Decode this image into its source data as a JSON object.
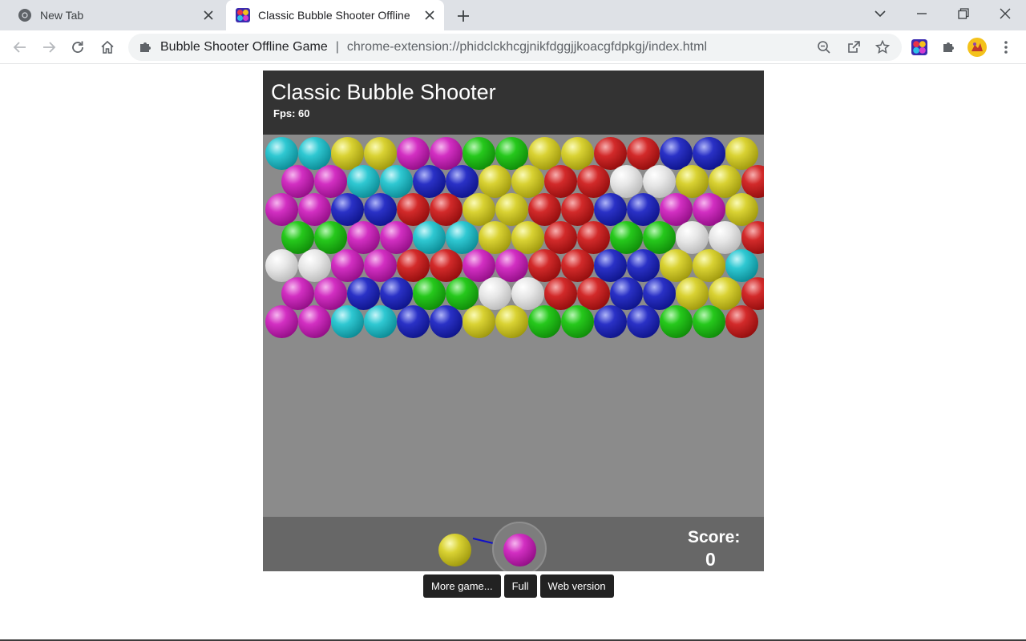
{
  "browser": {
    "tabs": [
      {
        "title": "New Tab",
        "icon": "chrome-icon",
        "active": false
      },
      {
        "title": "Classic Bubble Shooter Offline",
        "icon": "bubble-game-icon",
        "active": true
      }
    ],
    "address_bar": {
      "site_name": "Bubble Shooter Offline Game",
      "url": "chrome-extension://phidclckhcgjnikfdggjjkoacgfdpkgj/index.html"
    }
  },
  "game": {
    "title": "Classic Bubble Shooter",
    "fps": "Fps: 60",
    "score_label": "Score:",
    "score_value": "0",
    "grid": {
      "rows": [
        [
          "cyan",
          "cyan",
          "yellow",
          "yellow",
          "magenta",
          "magenta",
          "green",
          "green",
          "yellow",
          "yellow",
          "red",
          "red",
          "blue",
          "blue",
          "yellow"
        ],
        [
          "magenta",
          "magenta",
          "cyan",
          "cyan",
          "blue",
          "blue",
          "yellow",
          "yellow",
          "red",
          "red",
          "white",
          "white",
          "yellow",
          "yellow",
          "red"
        ],
        [
          "magenta",
          "magenta",
          "blue",
          "blue",
          "red",
          "red",
          "yellow",
          "yellow",
          "red",
          "red",
          "blue",
          "blue",
          "magenta",
          "magenta",
          "yellow"
        ],
        [
          "green",
          "green",
          "magenta",
          "magenta",
          "cyan",
          "cyan",
          "yellow",
          "yellow",
          "red",
          "red",
          "green",
          "green",
          "white",
          "white",
          "red"
        ],
        [
          "white",
          "white",
          "magenta",
          "magenta",
          "red",
          "red",
          "magenta",
          "magenta",
          "red",
          "red",
          "blue",
          "blue",
          "yellow",
          "yellow",
          "cyan"
        ],
        [
          "magenta",
          "magenta",
          "blue",
          "blue",
          "green",
          "green",
          "white",
          "white",
          "red",
          "red",
          "blue",
          "blue",
          "yellow",
          "yellow",
          "red"
        ],
        [
          "magenta",
          "magenta",
          "cyan",
          "cyan",
          "blue",
          "blue",
          "yellow",
          "yellow",
          "green",
          "green",
          "blue",
          "blue",
          "green",
          "green",
          "red"
        ]
      ]
    },
    "next_bubble": "yellow",
    "current_bubble": "magenta",
    "buttons": {
      "more_games": "More game...",
      "full": "Full",
      "web_version": "Web version"
    }
  },
  "colors": {
    "aim_line": "#1010c8"
  }
}
